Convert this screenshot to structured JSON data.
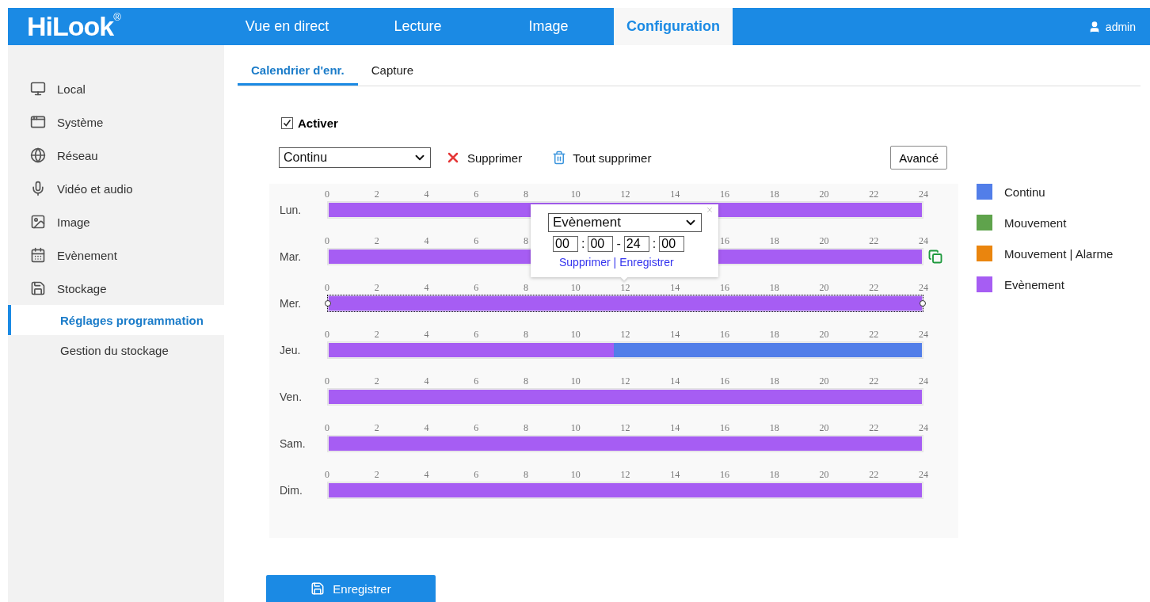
{
  "header": {
    "logo": "HiLook",
    "logo_mark": "®",
    "nav": [
      {
        "label": "Vue en direct",
        "selected": false
      },
      {
        "label": "Lecture",
        "selected": false
      },
      {
        "label": "Image",
        "selected": false
      },
      {
        "label": "Configuration",
        "selected": true
      }
    ],
    "user": "admin"
  },
  "sidebar": {
    "items": [
      {
        "label": "Local"
      },
      {
        "label": "Système"
      },
      {
        "label": "Réseau"
      },
      {
        "label": "Vidéo et audio"
      },
      {
        "label": "Image"
      },
      {
        "label": "Evènement"
      },
      {
        "label": "Stockage",
        "children": [
          {
            "label": "Réglages programmation",
            "selected": true
          },
          {
            "label": "Gestion du stockage",
            "selected": false
          }
        ]
      }
    ]
  },
  "tabs": [
    {
      "label": "Calendrier d'enr.",
      "selected": true
    },
    {
      "label": "Capture",
      "selected": false
    }
  ],
  "enable": {
    "label": "Activer",
    "checked": true
  },
  "toolbar": {
    "type_select": "Continu",
    "delete": "Supprimer",
    "delete_all": "Tout supprimer",
    "advanced": "Avancé"
  },
  "schedule": {
    "days": [
      {
        "label": "Lun.",
        "selected": false,
        "copy": false,
        "tick_groups": [
          [
            "0",
            "2",
            "4",
            "6",
            "8",
            "10",
            "12",
            "14",
            "16",
            "18",
            "20",
            "22",
            "24"
          ]
        ],
        "segments": [
          {
            "color": "#a65df3",
            "level": 1
          }
        ]
      },
      {
        "label": "Mar.",
        "selected": false,
        "copy": true,
        "tick_groups": [
          [
            "0",
            "2",
            "4",
            "6",
            "8"
          ],
          [
            "16",
            "18",
            "20",
            "22",
            "24"
          ]
        ],
        "segments": [
          {
            "color": "#a65df3",
            "level": 1
          }
        ]
      },
      {
        "label": "Mer.",
        "selected": true,
        "copy": false,
        "tick_groups": [
          [
            "0",
            "2",
            "4",
            "6",
            "8",
            "10",
            "12",
            "14",
            "16",
            "18",
            "20",
            "22",
            "24"
          ]
        ],
        "segments": [
          {
            "color": "#a65df3",
            "level": 1
          }
        ]
      },
      {
        "label": "Jeu.",
        "selected": false,
        "copy": false,
        "tick_groups": [
          [
            "0",
            "2",
            "4",
            "6",
            "8",
            "10",
            "12",
            "14",
            "16",
            "18",
            "20",
            "22",
            "24"
          ]
        ],
        "segments": [
          {
            "color": "#a65df3",
            "level": 0.48
          },
          {
            "color": "#527ee9",
            "level": 0.52
          }
        ]
      },
      {
        "label": "Ven.",
        "selected": false,
        "copy": false,
        "tick_groups": [
          [
            "0",
            "2",
            "4",
            "6",
            "8",
            "10",
            "12",
            "14",
            "16",
            "18",
            "20",
            "22",
            "24"
          ]
        ],
        "segments": [
          {
            "color": "#a65df3",
            "level": 1
          }
        ]
      },
      {
        "label": "Sam.",
        "selected": false,
        "copy": false,
        "tick_groups": [
          [
            "0",
            "2",
            "4",
            "6",
            "8",
            "10",
            "12",
            "14",
            "16",
            "18",
            "20",
            "22",
            "24"
          ]
        ],
        "segments": [
          {
            "color": "#a65df3",
            "level": 1
          }
        ]
      },
      {
        "label": "Dim.",
        "selected": false,
        "copy": false,
        "tick_groups": [
          [
            "0",
            "2",
            "4",
            "6",
            "8",
            "10",
            "12",
            "14",
            "16",
            "18",
            "20",
            "22",
            "24"
          ]
        ],
        "segments": [
          {
            "color": "#a65df3",
            "level": 1
          }
        ]
      }
    ],
    "popup": {
      "type_select": "Evènement",
      "time_fields": [
        "00",
        "00",
        "24",
        "00"
      ],
      "separators": [
        ":",
        "-",
        ":"
      ],
      "links": [
        "Supprimer",
        "Enregistrer"
      ],
      "link_separator": "|"
    }
  },
  "legend": [
    {
      "label": "Continu",
      "color": "#527ee9"
    },
    {
      "label": "Mouvement",
      "color": "#5fa34c"
    },
    {
      "label": "Mouvement | Alarme",
      "color": "#ea850e"
    },
    {
      "label": "Evènement",
      "color": "#a65df3"
    }
  ],
  "save_button": "Enregistrer"
}
